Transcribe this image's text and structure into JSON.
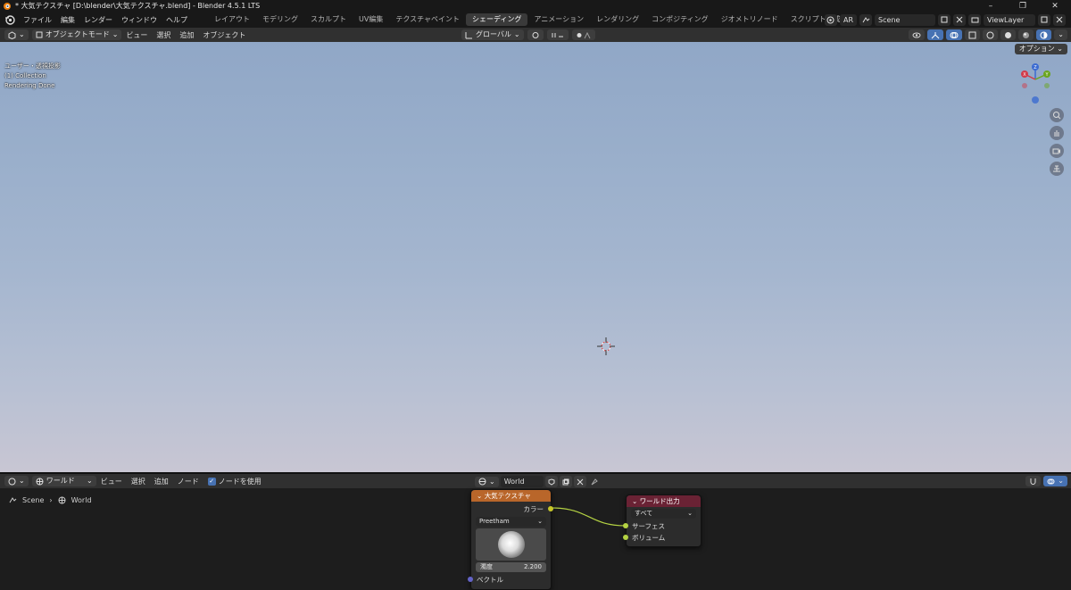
{
  "window": {
    "title": "* 大気テクスチャ [D:\\blender\\大気テクスチャ.blend] - Blender 4.5.1 LTS"
  },
  "menu": [
    "ファイル",
    "編集",
    "レンダー",
    "ウィンドウ",
    "ヘルプ"
  ],
  "workspaces": {
    "tabs": [
      "レイアウト",
      "モデリング",
      "スカルプト",
      "UV編集",
      "テクスチャペイント",
      "シェーディング",
      "アニメーション",
      "レンダリング",
      "コンポジティング",
      "ジオメトリノード",
      "スクリプト作成"
    ],
    "active": "シェーディング",
    "add": "+"
  },
  "scene_bar": {
    "ar": "AR",
    "scene": "Scene",
    "view_layer": "ViewLayer"
  },
  "viewport": {
    "mode": "オブジェクトモード",
    "menus": [
      "ビュー",
      "選択",
      "追加",
      "オブジェクト"
    ],
    "transform_orientation": "グローバル",
    "options": "オプション",
    "info_lines": [
      "ユーザー・透視投影",
      "(1) Collection",
      "Rendering Done"
    ],
    "gizmo_axes": {
      "x": "X",
      "y": "Y",
      "z": "Z"
    }
  },
  "node_editor": {
    "type": "ワールド",
    "menus": [
      "ビュー",
      "選択",
      "追加",
      "ノード"
    ],
    "use_nodes_label": "ノードを使用",
    "world_name": "World",
    "breadcrumb": [
      "Scene",
      "World"
    ],
    "sky_node": {
      "title": "大気テクスチャ",
      "output": "カラー",
      "sky_type": "Preetham",
      "turbidity_label": "濁度",
      "turbidity_value": "2.200",
      "input": "ベクトル"
    },
    "output_node": {
      "title": "ワールド出力",
      "target": "すべて",
      "inputs": [
        "サーフェス",
        "ボリューム"
      ]
    }
  },
  "colors": {
    "sky_node_header": "#b9662a",
    "output_node_header": "#6a2234",
    "socket_color": "#c7c729",
    "socket_vector": "#6363c7",
    "link_color": "#b5d343",
    "accent": "#4772b3"
  }
}
